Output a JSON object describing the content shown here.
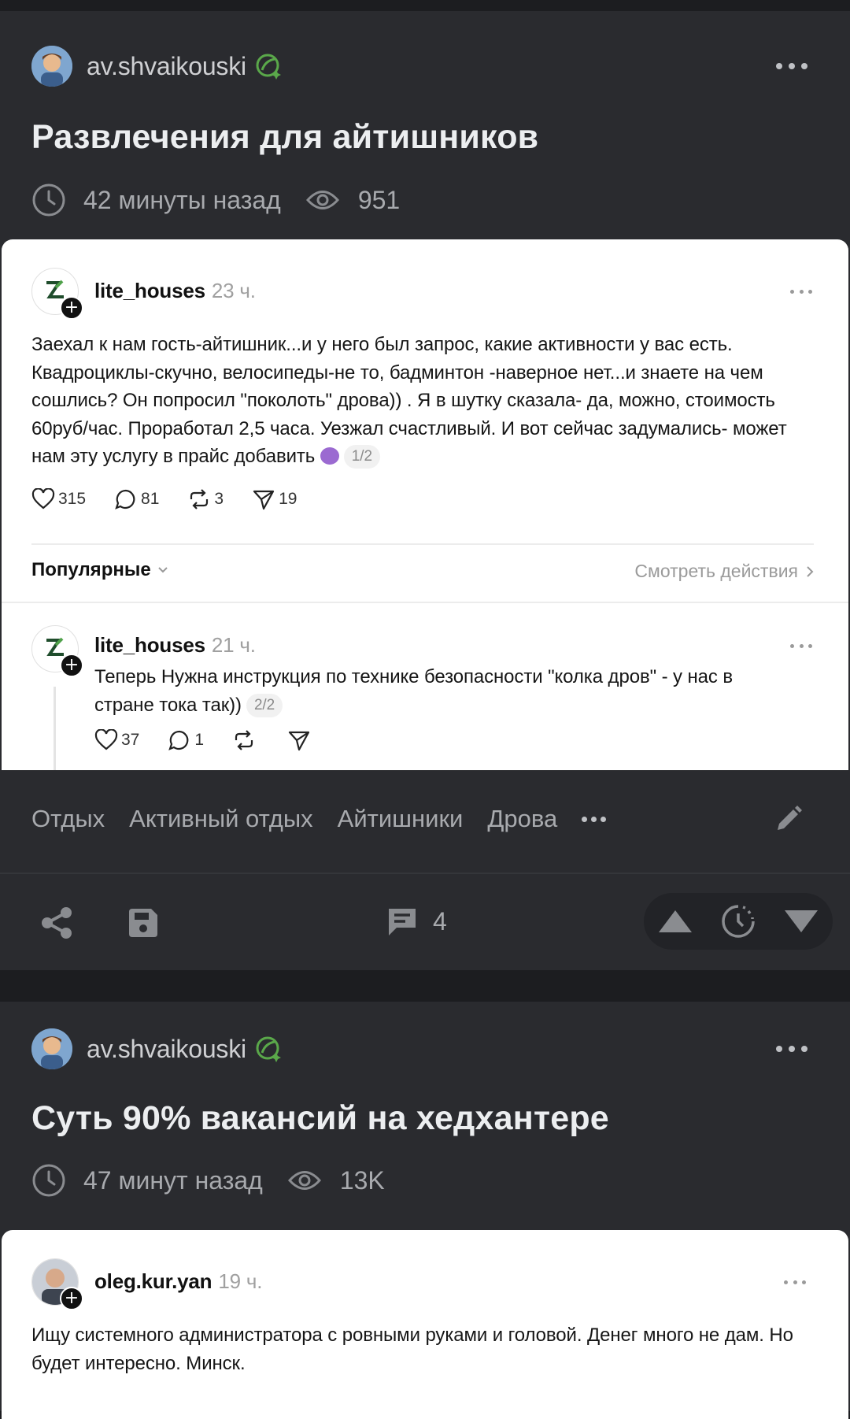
{
  "posts": [
    {
      "author": "av.shvaikouski",
      "title": "Развлечения для айтишников",
      "time": "42 минуты назад",
      "views": "951",
      "embed": {
        "author": "lite_houses",
        "time": "23 ч.",
        "text": "Заехал к нам гость-айтишник...и у него был запрос, какие активности у вас есть. Квадроциклы-скучно, велосипеды-не то, бадминтон -наверное нет...и знаете на чем сошлись? Он попросил \"поколоть\" дрова)) . Я в шутку сказала- да, можно, стоимость 60руб/час. Проработал 2,5 часа. Уезжал счастливый. И вот сейчас задумались- может нам эту услугу в прайс добавить",
        "pill": "1/2",
        "likes": "315",
        "comments": "81",
        "reposts": "3",
        "shares": "19",
        "sort_label": "Популярные",
        "view_actions": "Смотреть действия",
        "reply": {
          "author": "lite_houses",
          "time": "21 ч.",
          "text": "Теперь Нужна инструкция по технике безопасности \"колка дров\" - у нас в стране тока так))",
          "pill": "2/2",
          "likes": "37",
          "comments": "1"
        }
      },
      "tags": [
        "Отдых",
        "Активный отдых",
        "Айтишники",
        "Дрова"
      ],
      "comments_count": "4"
    },
    {
      "author": "av.shvaikouski",
      "title": "Суть 90% вакансий на хедхантере",
      "time": "47 минут назад",
      "views": "13K",
      "embed": {
        "author": "oleg.kur.yan",
        "time": "19 ч.",
        "text": "Ищу системного администратора с ровными руками и головой. Денег много не дам. Но будет интересно. Минск."
      }
    }
  ],
  "colors": {
    "background": "#1c1d20",
    "post": "#2a2b2f",
    "badge": "#5aa84a",
    "card": "#ffffff"
  },
  "icons": [
    "clock-icon",
    "eye-icon",
    "heart-icon",
    "comment-icon",
    "repost-icon",
    "send-icon",
    "chevron-down-icon",
    "chevron-right-icon",
    "pencil-icon",
    "share-icon",
    "save-icon",
    "comments-icon",
    "upvote-icon",
    "timer-icon",
    "downvote-icon"
  ]
}
